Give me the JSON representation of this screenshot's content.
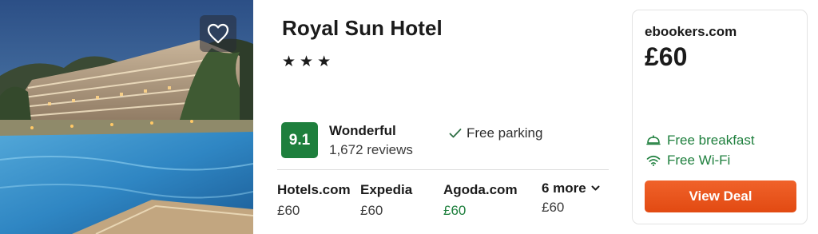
{
  "hotel": {
    "name": "Royal Sun Hotel",
    "stars": "★★★",
    "star_count": 3,
    "favorite_icon": "heart-icon"
  },
  "rating": {
    "score": "9.1",
    "label": "Wonderful",
    "reviews": "1,672 reviews",
    "badge_color": "#1e7f3d"
  },
  "amenities_middle": {
    "parking_icon": "check-icon",
    "parking_label": "Free parking"
  },
  "providers": [
    {
      "name": "Hotels.com",
      "price": "£60"
    },
    {
      "name": "Expedia",
      "price": "£60"
    },
    {
      "name": "Agoda.com",
      "price": "£60",
      "highlight": true
    },
    {
      "name": "6 more",
      "price": "£60",
      "icon": "chevron-down-icon"
    }
  ],
  "deal": {
    "site": "ebookers.com",
    "price": "£60",
    "amenities": [
      {
        "icon": "breakfast-icon",
        "label": "Free breakfast"
      },
      {
        "icon": "wifi-icon",
        "label": "Free Wi-Fi"
      }
    ],
    "button_label": "View Deal",
    "button_color": "#e8541e",
    "amenity_color": "#1e7f3d"
  }
}
